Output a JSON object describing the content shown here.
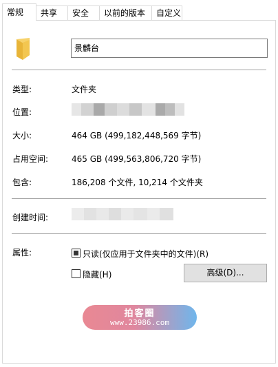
{
  "tabs": [
    "常规",
    "共享",
    "安全",
    "以前的版本",
    "自定义"
  ],
  "folder": {
    "name": "景麟台",
    "icon": "folder-icon"
  },
  "general": {
    "type_label": "类型:",
    "type_value": "文件夹",
    "location_label": "位置:",
    "size_label": "大小:",
    "size_value": "464 GB (499,182,448,569 字节)",
    "disk_size_label": "占用空间:",
    "disk_size_value": "465 GB (499,563,806,720 字节)",
    "contains_label": "包含:",
    "contains_value": "186,208 个文件, 10,214 个文件夹",
    "created_label": "创建时间:",
    "attributes_label": "属性:"
  },
  "attributes": {
    "readonly_label": "只读(仅应用于文件夹中的文件)(R)",
    "readonly_state": "indeterminate",
    "hidden_label": "隐藏(H)",
    "hidden_checked": false,
    "advanced_button": "高级(D)..."
  },
  "watermark": {
    "title": "拍客圈",
    "url": "www.23986.com"
  },
  "colors": {
    "separator": "#a0a0a0",
    "folder": "#f3c650",
    "button_bg": "#e1e1e1"
  }
}
